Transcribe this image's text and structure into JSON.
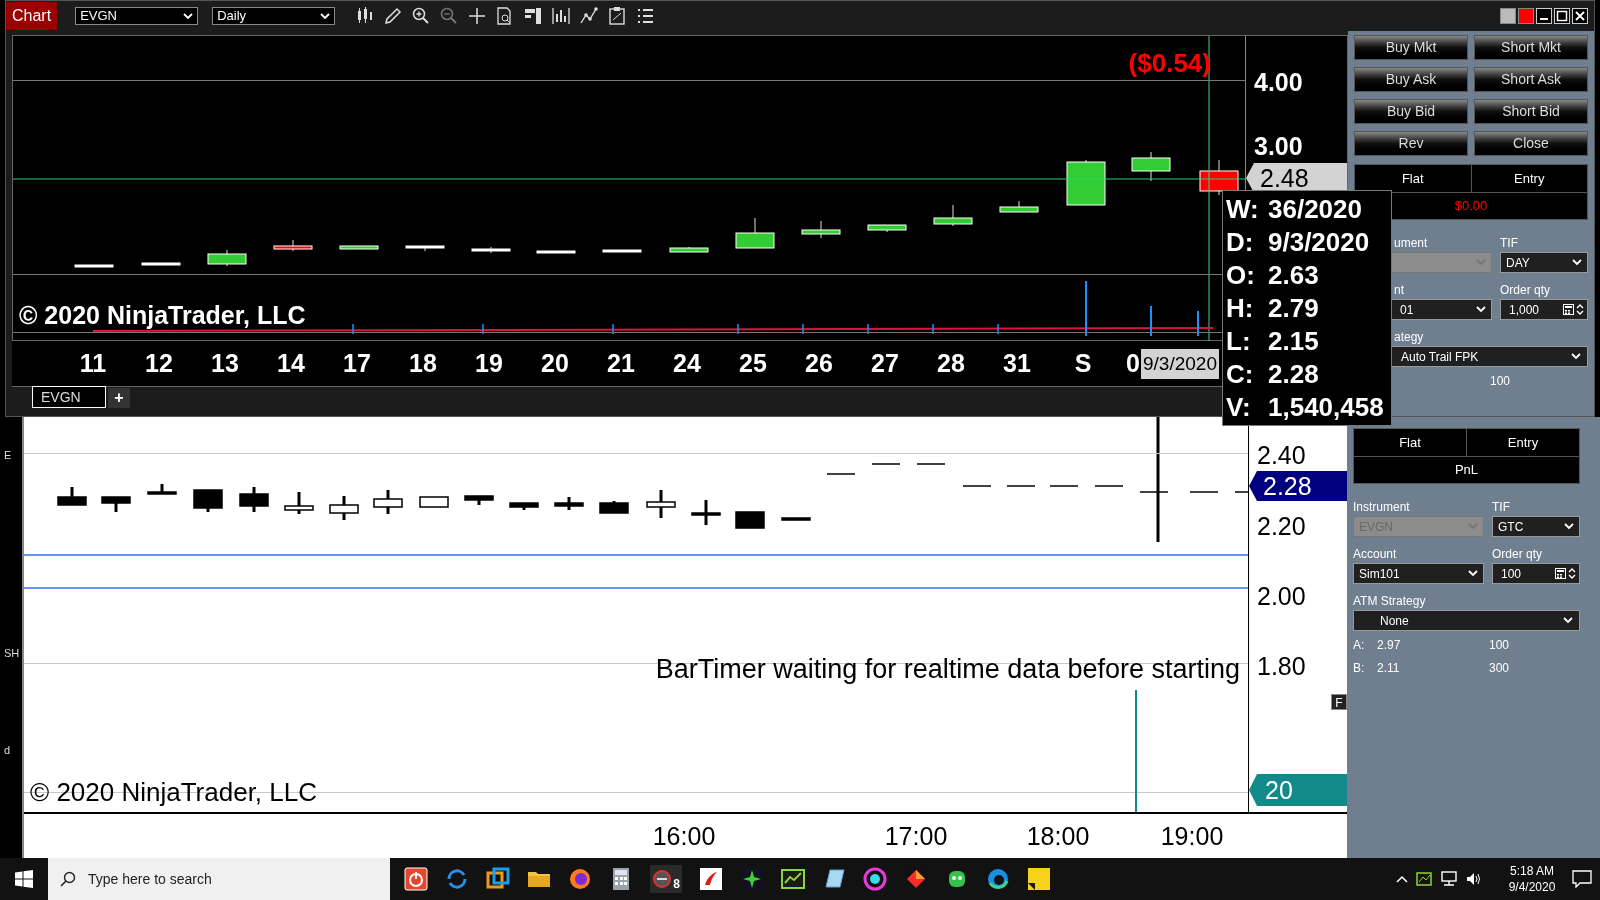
{
  "front_window": {
    "title_badge": "Chart",
    "instrument": "EVGN",
    "interval": "Daily",
    "pnl_overlay": "($0.54)",
    "price_labels": [
      "4.00",
      "3.00"
    ],
    "last_price_marker": "2.48",
    "copyright": "© 2020 NinjaTrader, LLC",
    "date_labels": [
      "11",
      "12",
      "13",
      "14",
      "17",
      "18",
      "19",
      "20",
      "21",
      "24",
      "25",
      "26",
      "27",
      "28",
      "31",
      "S",
      "0"
    ],
    "cursor_date": "9/3/2020",
    "tabs": [
      {
        "label": "EVGN",
        "selected": true
      }
    ],
    "add_tab": "+",
    "order_buttons": [
      "Buy Mkt",
      "Short Mkt",
      "Buy Ask",
      "Short Ask",
      "Buy Bid",
      "Short Bid",
      "Rev",
      "Close"
    ],
    "position": {
      "columns": [
        "Flat",
        "Entry"
      ],
      "pnl": "$0.00"
    },
    "fields": [
      {
        "kind": "dropdown",
        "label": "ument",
        "disabled": true
      },
      {
        "kind": "dropdown",
        "label": "TIF",
        "value": "DAY",
        "disabled": false
      },
      {
        "kind": "dropdown",
        "label": "nt",
        "value": "01",
        "disabled": false
      },
      {
        "kind": "spinner",
        "label": "Order qty",
        "value": "1,000",
        "disabled": false
      }
    ],
    "atm": {
      "label": "ategy",
      "value": "Auto Trail FPK"
    },
    "quotes": [
      {
        "size": "100"
      }
    ]
  },
  "tooltip": [
    {
      "key": "W:",
      "value": "36/2020"
    },
    {
      "key": "D:",
      "value": "9/3/2020"
    },
    {
      "key": "O:",
      "value": "2.63"
    },
    {
      "key": "H:",
      "value": "2.79"
    },
    {
      "key": "L:",
      "value": "2.15"
    },
    {
      "key": "C:",
      "value": "2.28"
    },
    {
      "key": "V:",
      "value": "1,540,458"
    }
  ],
  "back_window": {
    "price_labels": [
      "2.40",
      "2.20",
      "2.00",
      "1.80"
    ],
    "last_price_marker": "2.28",
    "status_message": "BarTimer waiting for realtime data before starting",
    "copyright": "© 2020 NinjaTrader, LLC",
    "volume_marker": "20",
    "flag": "F",
    "time_labels": [
      "16:00",
      "17:00",
      "18:00",
      "19:00"
    ],
    "position": {
      "columns": [
        "Flat",
        "Entry"
      ],
      "pnl": "PnL"
    },
    "fields": [
      {
        "kind": "dropdown",
        "label": "Instrument",
        "value": "EVGN",
        "disabled": true
      },
      {
        "kind": "dropdown",
        "label": "TIF",
        "value": "GTC",
        "disabled": false
      },
      {
        "kind": "dropdown",
        "label": "Account",
        "value": "Sim101",
        "disabled": false
      },
      {
        "kind": "spinner",
        "label": "Order qty",
        "value": "100",
        "disabled": false
      }
    ],
    "atm": {
      "label": "ATM Strategy",
      "value": "None"
    },
    "quotes": [
      {
        "label": "A:",
        "price": "2.97",
        "size": "100"
      },
      {
        "label": "B:",
        "price": "2.11",
        "size": "300"
      }
    ]
  },
  "left_edge_fragments": [
    "E",
    "SH",
    "d"
  ],
  "taskbar": {
    "search_placeholder": "Type here to search",
    "app_badge": "8",
    "time": "5:18 AM",
    "date": "9/4/2020"
  }
}
